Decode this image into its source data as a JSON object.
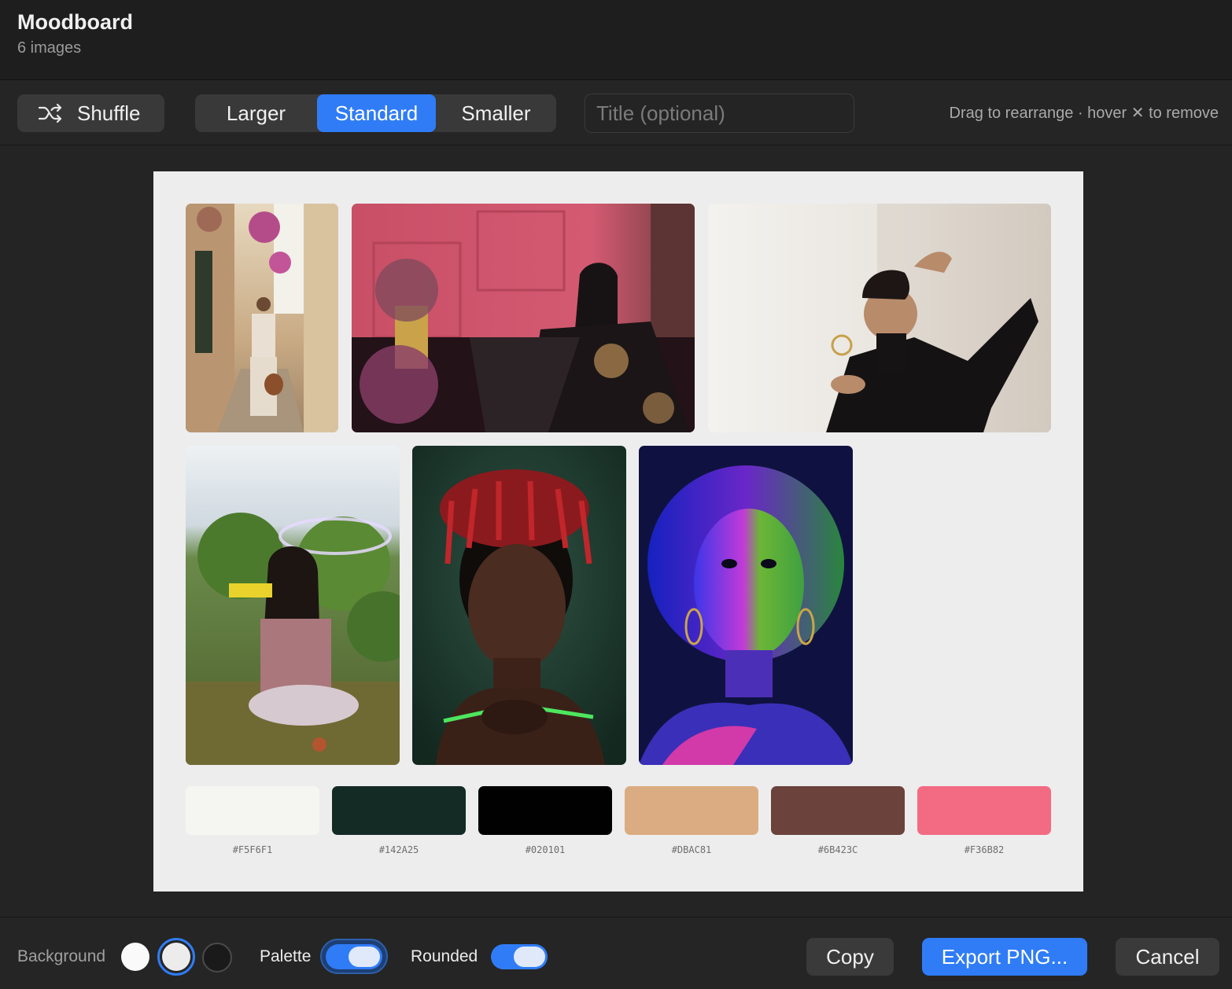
{
  "header": {
    "title": "Moodboard",
    "subtitle": "6 images"
  },
  "toolbar": {
    "shuffle_label": "Shuffle",
    "size_options": [
      "Larger",
      "Standard",
      "Smaller"
    ],
    "size_selected": "Standard",
    "title_placeholder": "Title (optional)",
    "title_value": "",
    "hint": "Drag to rearrange · hover ✕ to remove"
  },
  "board": {
    "background": "#EDEDED",
    "photos": [
      {
        "icon": "alley-woman-photo"
      },
      {
        "icon": "pink-wall-seated-woman-photo"
      },
      {
        "icon": "black-dress-portrait-photo"
      },
      {
        "icon": "bubble-girl-photo"
      },
      {
        "icon": "braids-portrait-photo"
      },
      {
        "icon": "neon-light-portrait-photo"
      }
    ],
    "palette": [
      "#F5F6F1",
      "#142A25",
      "#020101",
      "#DBAC81",
      "#6B423C",
      "#F36B82"
    ]
  },
  "bottom": {
    "background_label": "Background",
    "background_options": [
      "white",
      "light",
      "dark"
    ],
    "background_selected": "light",
    "palette_label": "Palette",
    "palette_on": true,
    "rounded_label": "Rounded",
    "rounded_on": true,
    "copy_label": "Copy",
    "export_label": "Export PNG...",
    "cancel_label": "Cancel"
  },
  "colors": {
    "accent": "#2F7CF6",
    "chrome": "#242424"
  }
}
